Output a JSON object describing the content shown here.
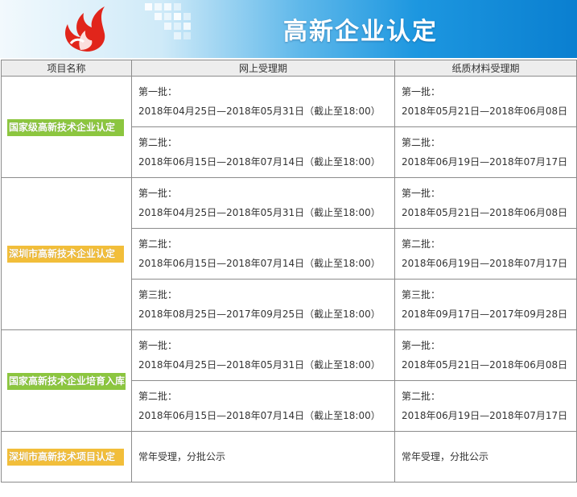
{
  "banner": {
    "title": "高新企业认定"
  },
  "header": {
    "col1": "项目名称",
    "col2": "网上受理期",
    "col3": "纸质材料受理期"
  },
  "colors": {
    "green_label": "#8cc63f",
    "yellow_label": "#f2be3a",
    "logo_red": "#e1251b"
  },
  "rows": [
    {
      "name": "国家级高新技术企业认定",
      "batches": [
        {
          "online_label": "第一批：",
          "online": "2018年04月25日—2018年05月31日（截止至18:00）",
          "paper_label": "第一批：",
          "paper": "2018年05月21日—2018年06月08日"
        },
        {
          "online_label": "第二批：",
          "online": "2018年06月15日—2018年07月14日（截止至18:00）",
          "paper_label": "第二批：",
          "paper": "2018年06月19日—2018年07月17日"
        }
      ]
    },
    {
      "name": "深圳市高新技术企业认定",
      "batches": [
        {
          "online_label": "第一批：",
          "online": "2018年04月25日—2018年05月31日（截止至18:00）",
          "paper_label": "第一批：",
          "paper": "2018年05月21日—2018年06月08日"
        },
        {
          "online_label": "第二批：",
          "online": "2018年06月15日—2018年07月14日（截止至18:00）",
          "paper_label": "第二批：",
          "paper": "2018年06月19日—2018年07月17日"
        },
        {
          "online_label": "第三批：",
          "online": "2018年08月25日—2017年09月25日（截止至18:00）",
          "paper_label": "第三批：",
          "paper": "2018年09月17日—2017年09月28日"
        }
      ]
    },
    {
      "name": "国家高新技术企业培育入库",
      "batches": [
        {
          "online_label": "第一批：",
          "online": "2018年04月25日—2018年05月31日（截止至18:00）",
          "paper_label": "第一批：",
          "paper": "2018年05月21日—2018年06月08日"
        },
        {
          "online_label": "第二批：",
          "online": "2018年06月15日—2018年07月14日（截止至18:00）",
          "paper_label": "第二批：",
          "paper": "2018年06月19日—2018年07月17日"
        }
      ]
    },
    {
      "name": "深圳市高新技术项目认定",
      "online": "常年受理，分批公示",
      "paper": "常年受理，分批公示"
    }
  ]
}
